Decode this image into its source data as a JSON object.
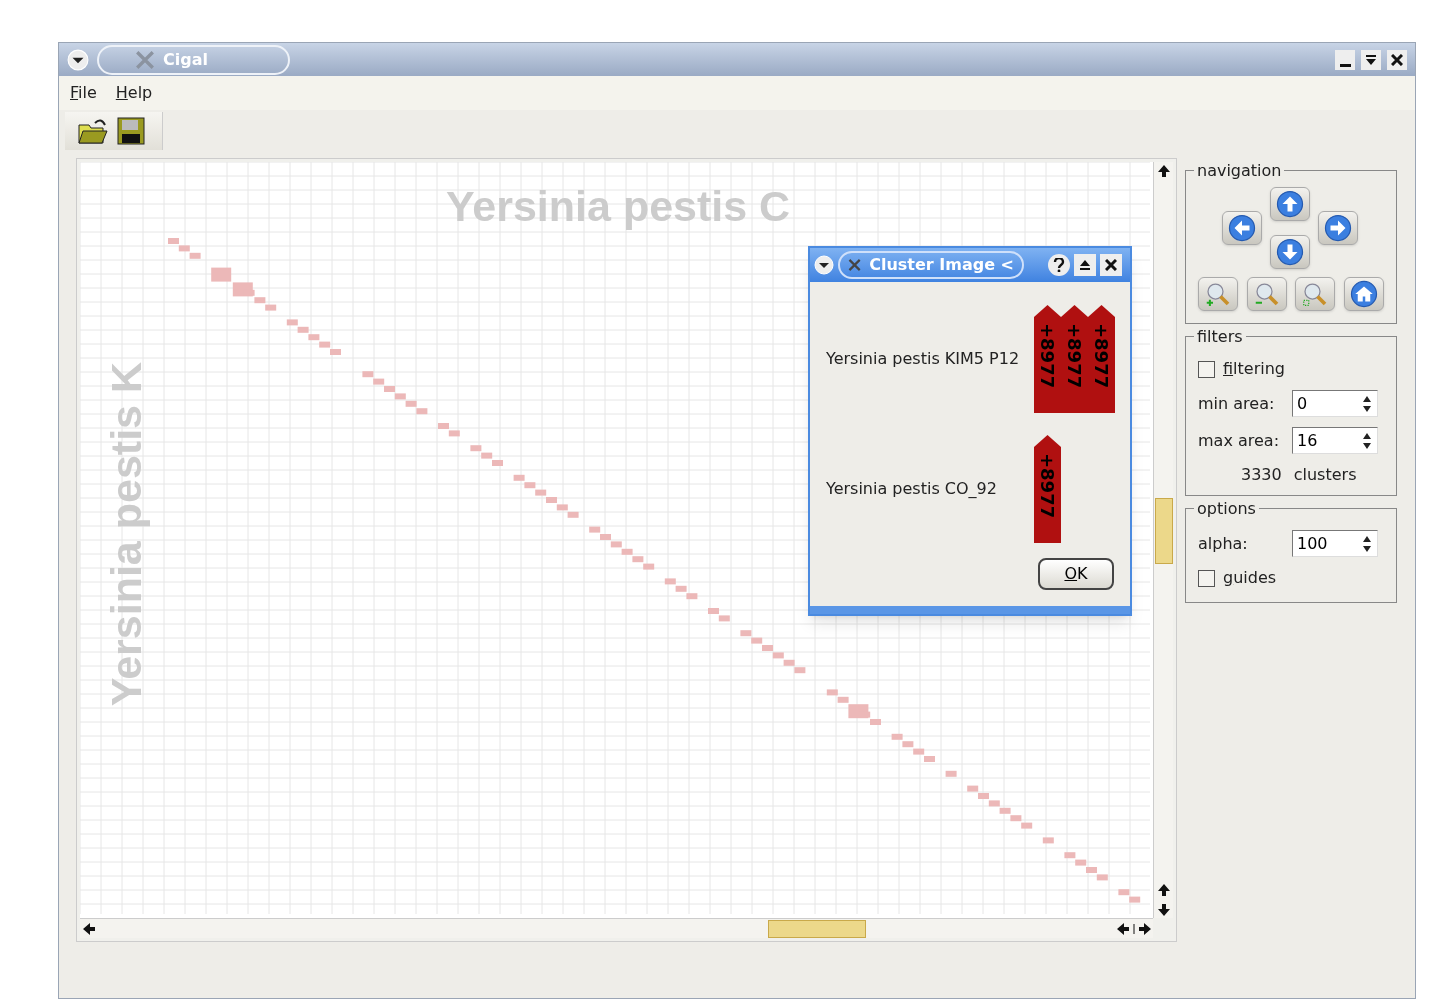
{
  "window": {
    "title": "Cigal"
  },
  "menu": [
    {
      "label": "File"
    },
    {
      "label": "Help"
    }
  ],
  "plot": {
    "x_title": "Yersinia pestis C",
    "y_title": "Yersinia pestis K"
  },
  "dialog": {
    "title": "Cluster Image <",
    "rows": [
      {
        "label": "Yersinia pestis KIM5 P12",
        "tags": [
          "+8977",
          "+8977",
          "+8977"
        ]
      },
      {
        "label": "Yersinia pestis CO_92",
        "tags": [
          "+8977"
        ]
      }
    ],
    "ok": "OK"
  },
  "navigation": {
    "title": "navigation"
  },
  "filters": {
    "title": "filters",
    "filtering": {
      "label": "filtering",
      "checked": false
    },
    "fields": [
      {
        "label": "min area:",
        "value": "0"
      },
      {
        "label": "max area:",
        "value": "16"
      }
    ],
    "count": "3330",
    "count_label": "clusters"
  },
  "options": {
    "title": "options",
    "fields": [
      {
        "label": "alpha:",
        "value": "100"
      }
    ],
    "guides": {
      "label": "guides",
      "checked": false
    }
  }
}
